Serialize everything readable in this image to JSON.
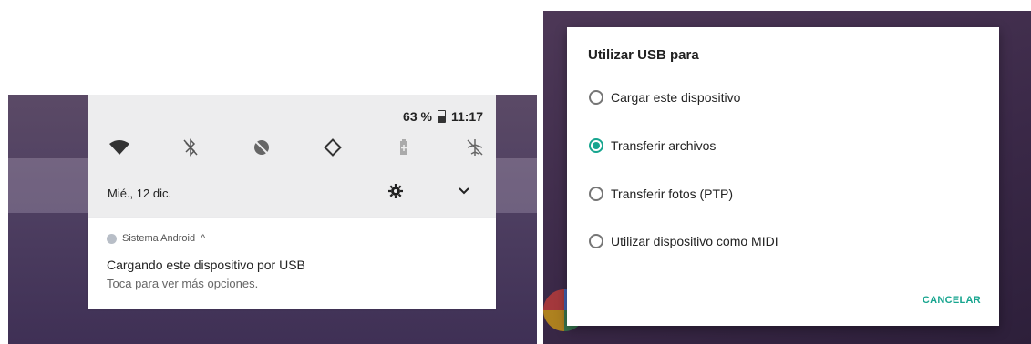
{
  "left": {
    "status": {
      "battery": "63 %",
      "time": "11:17"
    },
    "quick_settings": [
      {
        "name": "wifi-icon"
      },
      {
        "name": "bluetooth-off-icon"
      },
      {
        "name": "do-not-disturb-icon"
      },
      {
        "name": "auto-rotate-icon"
      },
      {
        "name": "battery-saver-icon"
      },
      {
        "name": "airplane-mode-icon"
      }
    ],
    "date": "Mié., 12 dic.",
    "notification": {
      "app_name": "Sistema Android",
      "expand_glyph": "^",
      "title": "Cargando este dispositivo por USB",
      "text": "Toca para ver más opciones."
    }
  },
  "dialog": {
    "title": "Utilizar USB para",
    "options": [
      {
        "label": "Cargar este dispositivo",
        "checked": false
      },
      {
        "label": "Transferir archivos",
        "checked": true
      },
      {
        "label": "Transferir fotos (PTP)",
        "checked": false
      },
      {
        "label": "Utilizar dispositivo como MIDI",
        "checked": false
      }
    ],
    "cancel_label": "CANCELAR",
    "accent_color": "#17a58f"
  }
}
